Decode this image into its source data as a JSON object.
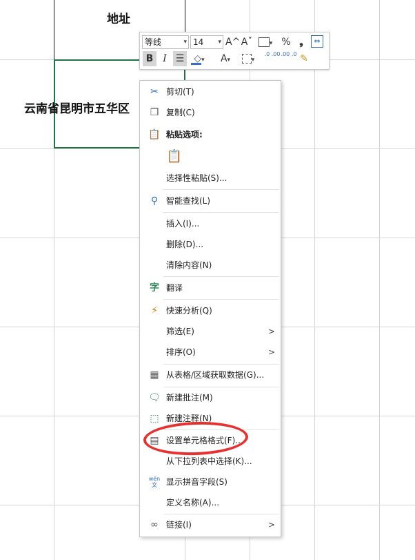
{
  "sheet": {
    "header_cell_text": "地址",
    "selected_cell_text": "云南省昆明市五华区"
  },
  "mini_toolbar": {
    "font_name": "等线",
    "font_size": "14",
    "buttons": {
      "grow_font": "A^",
      "shrink_font": "Aˇ",
      "percent": "%",
      "comma": "❟",
      "bold": "B",
      "italic": "I",
      "font_color": "A",
      "increase_decimal": ".0 .00",
      "decrease_decimal": ".00 .0"
    }
  },
  "context_menu": {
    "items": [
      {
        "label": "剪切(T)",
        "icon": "scissors-icon"
      },
      {
        "label": "复制(C)",
        "icon": "copy-icon"
      },
      {
        "label": "粘贴选项:",
        "icon": "clipboard-icon"
      },
      {
        "label": "选择性粘贴(S)...",
        "icon": ""
      },
      {
        "label": "智能查找(L)",
        "icon": "search-icon"
      },
      {
        "label": "插入(I)...",
        "icon": ""
      },
      {
        "label": "删除(D)...",
        "icon": ""
      },
      {
        "label": "清除内容(N)",
        "icon": ""
      },
      {
        "label": "翻译",
        "icon": "translate-icon"
      },
      {
        "label": "快速分析(Q)",
        "icon": "quick-analysis-icon"
      },
      {
        "label": "筛选(E)",
        "icon": "",
        "submenu": true
      },
      {
        "label": "排序(O)",
        "icon": "",
        "submenu": true
      },
      {
        "label": "从表格/区域获取数据(G)...",
        "icon": "table-icon"
      },
      {
        "label": "新建批注(M)",
        "icon": "new-comment-icon"
      },
      {
        "label": "新建注释(N)",
        "icon": "new-note-icon"
      },
      {
        "label": "设置单元格格式(F)...",
        "icon": "format-cells-icon"
      },
      {
        "label": "从下拉列表中选择(K)...",
        "icon": ""
      },
      {
        "label": "显示拼音字段(S)",
        "icon": "phonetic-icon"
      },
      {
        "label": "定义名称(A)...",
        "icon": ""
      },
      {
        "label": "链接(I)",
        "icon": "link-icon",
        "submenu": true
      }
    ],
    "submenu_arrow": ">",
    "phonetic_icon_text": "wén"
  },
  "colors": {
    "selection_border": "#217346",
    "annotation_circle": "#e8312f",
    "grid": "#d4d4d4"
  }
}
